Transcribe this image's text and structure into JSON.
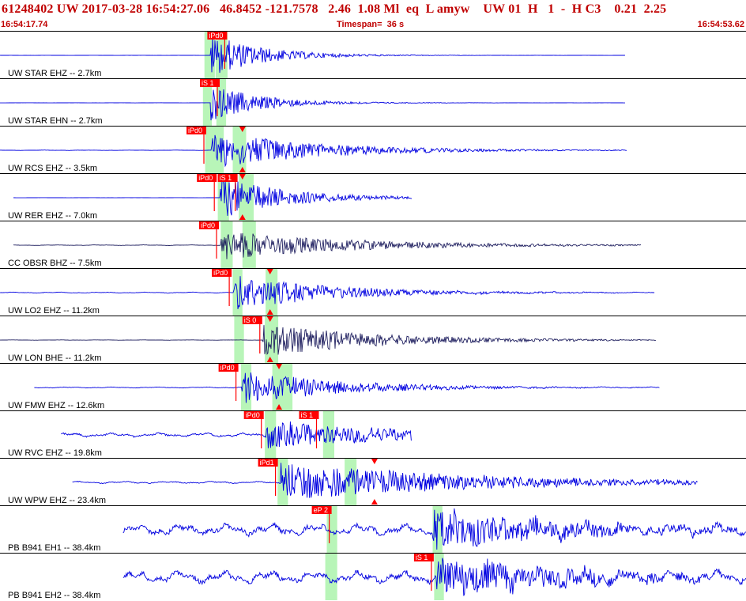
{
  "header": {
    "event_line": "61248402 UW 2017-03-28 16:54:27.06   46.8452 -121.7578   2.46  1.08 Ml  eq  L amyw    UW 01  H   1  -  H C3    0.21  2.25",
    "start_time": "16:54:17.74",
    "timespan": "Timespan=  36 s",
    "end_time": "16:54:53.62"
  },
  "colors": {
    "header_text": "#c00000",
    "trace_primary": "#0000e0",
    "trace_dark": "#202060",
    "pick_flag": "#ff0000",
    "pick_window": "#b8f5b8",
    "panel_border": "#000000"
  },
  "traces": [
    {
      "label": "UW STAR EHZ -- 2.7km",
      "color": "trace_primary",
      "start": 0.0,
      "end": 0.838,
      "noise": 0.01,
      "onset": 0.282,
      "amp": 1.0,
      "decay": 0.07,
      "picks": [
        {
          "text": "iPd0",
          "t": 0.278
        }
      ],
      "windows": [
        [
          0.274,
          0.288
        ],
        [
          0.289,
          0.305
        ]
      ]
    },
    {
      "label": "UW STAR EHN -- 2.7km",
      "color": "trace_primary",
      "start": 0.0,
      "end": 0.838,
      "noise": 0.01,
      "onset": 0.282,
      "amp": 0.85,
      "decay": 0.07,
      "picks": [
        {
          "text": "iS 1",
          "t": 0.268
        }
      ],
      "windows": [
        [
          0.272,
          0.284
        ],
        [
          0.29,
          0.303
        ]
      ]
    },
    {
      "label": "UW RCS EHZ -- 3.5km",
      "color": "trace_primary",
      "start": 0.0,
      "end": 0.841,
      "noise": 0.02,
      "onset": 0.283,
      "amp": 0.9,
      "decay": 0.14,
      "picks": [
        {
          "text": "iPd0",
          "t": 0.25
        }
      ],
      "windows": [
        [
          0.275,
          0.3
        ],
        [
          0.312,
          0.33
        ]
      ],
      "markers": [
        0.325
      ]
    },
    {
      "label": "UW RER EHZ -- 7.0km",
      "color": "trace_primary",
      "start": 0.018,
      "end": 0.552,
      "noise": 0.01,
      "onset": 0.295,
      "amp": 1.0,
      "decay": 0.09,
      "picks": [
        {
          "text": "iPd0",
          "t": 0.264
        },
        {
          "text": "iS 1",
          "t": 0.292
        }
      ],
      "windows": [
        [
          0.292,
          0.307
        ],
        [
          0.32,
          0.34
        ]
      ],
      "markers": [
        0.325
      ]
    },
    {
      "label": "CC OBSR BHZ -- 7.5km",
      "color": "trace_dark",
      "start": 0.018,
      "end": 0.86,
      "noise": 0.03,
      "onset": 0.296,
      "amp": 0.7,
      "decay": 0.17,
      "picks": [
        {
          "text": "iPd0",
          "t": 0.267
        }
      ],
      "windows": [
        [
          0.296,
          0.312
        ],
        [
          0.325,
          0.343
        ]
      ]
    },
    {
      "label": "UW LO2 EHZ -- 11.2km",
      "color": "trace_primary",
      "start": 0.0,
      "end": 0.878,
      "noise": 0.05,
      "onset": 0.313,
      "amp": 0.85,
      "decay": 0.13,
      "picks": [
        {
          "text": "iPd0",
          "t": 0.284
        }
      ],
      "windows": [
        [
          0.312,
          0.325
        ],
        [
          0.356,
          0.372
        ]
      ],
      "markers": [
        0.362
      ]
    },
    {
      "label": "UW LON BHE -- 11.2km",
      "color": "trace_dark",
      "start": 0.0,
      "end": 0.88,
      "noise": 0.02,
      "onset": 0.352,
      "amp": 0.8,
      "decay": 0.15,
      "picks": [
        {
          "text": "iS 0",
          "t": 0.325
        }
      ],
      "windows": [
        [
          0.314,
          0.327
        ],
        [
          0.355,
          0.373
        ]
      ],
      "markers": [
        0.362
      ]
    },
    {
      "label": "UW FMW EHZ -- 12.6km",
      "color": "trace_primary",
      "start": 0.046,
      "end": 0.884,
      "noise": 0.05,
      "onset": 0.324,
      "amp": 0.8,
      "decay": 0.13,
      "picks": [
        {
          "text": "iPd0",
          "t": 0.293
        }
      ],
      "windows": [
        [
          0.323,
          0.337
        ],
        [
          0.365,
          0.392
        ]
      ],
      "markers": [
        0.374
      ]
    },
    {
      "label": "UW RVC EHZ -- 19.8km",
      "color": "trace_primary",
      "start": 0.082,
      "end": 0.552,
      "noise": 0.2,
      "onset": 0.357,
      "amp": 0.65,
      "decay": 0.2,
      "picks": [
        {
          "text": "iPd0",
          "t": 0.327
        },
        {
          "text": "iS 1",
          "t": 0.401
        }
      ],
      "windows": [
        [
          0.355,
          0.37
        ],
        [
          0.433,
          0.448
        ]
      ]
    },
    {
      "label": "UW WPW EHZ -- 23.4km",
      "color": "trace_primary",
      "start": 0.097,
      "end": 0.935,
      "noise": 0.1,
      "onset": 0.376,
      "amp": 0.95,
      "decay": 0.25,
      "picks": [
        {
          "text": "iPd1",
          "t": 0.346
        }
      ],
      "windows": [
        [
          0.372,
          0.386
        ],
        [
          0.462,
          0.478
        ]
      ],
      "markers": [
        0.502
      ]
    },
    {
      "label": "PB B941 EH1 -- 38.4km",
      "color": "trace_primary",
      "start": 0.165,
      "end": 1.0,
      "noise": 0.55,
      "onset": 0.58,
      "amp": 0.95,
      "decay": 0.18,
      "picks": [
        {
          "text": "eP 2",
          "t": 0.418
        }
      ],
      "windows": [
        [
          0.438,
          0.452
        ],
        [
          0.58,
          0.593
        ]
      ]
    },
    {
      "label": "PB B941 EH2 -- 38.4km",
      "color": "trace_primary",
      "start": 0.165,
      "end": 1.0,
      "noise": 0.6,
      "onset": 0.585,
      "amp": 0.9,
      "decay": 0.18,
      "picks": [
        {
          "text": "iS 1",
          "t": 0.555
        }
      ],
      "windows": [
        [
          0.436,
          0.452
        ],
        [
          0.582,
          0.595
        ]
      ]
    }
  ]
}
